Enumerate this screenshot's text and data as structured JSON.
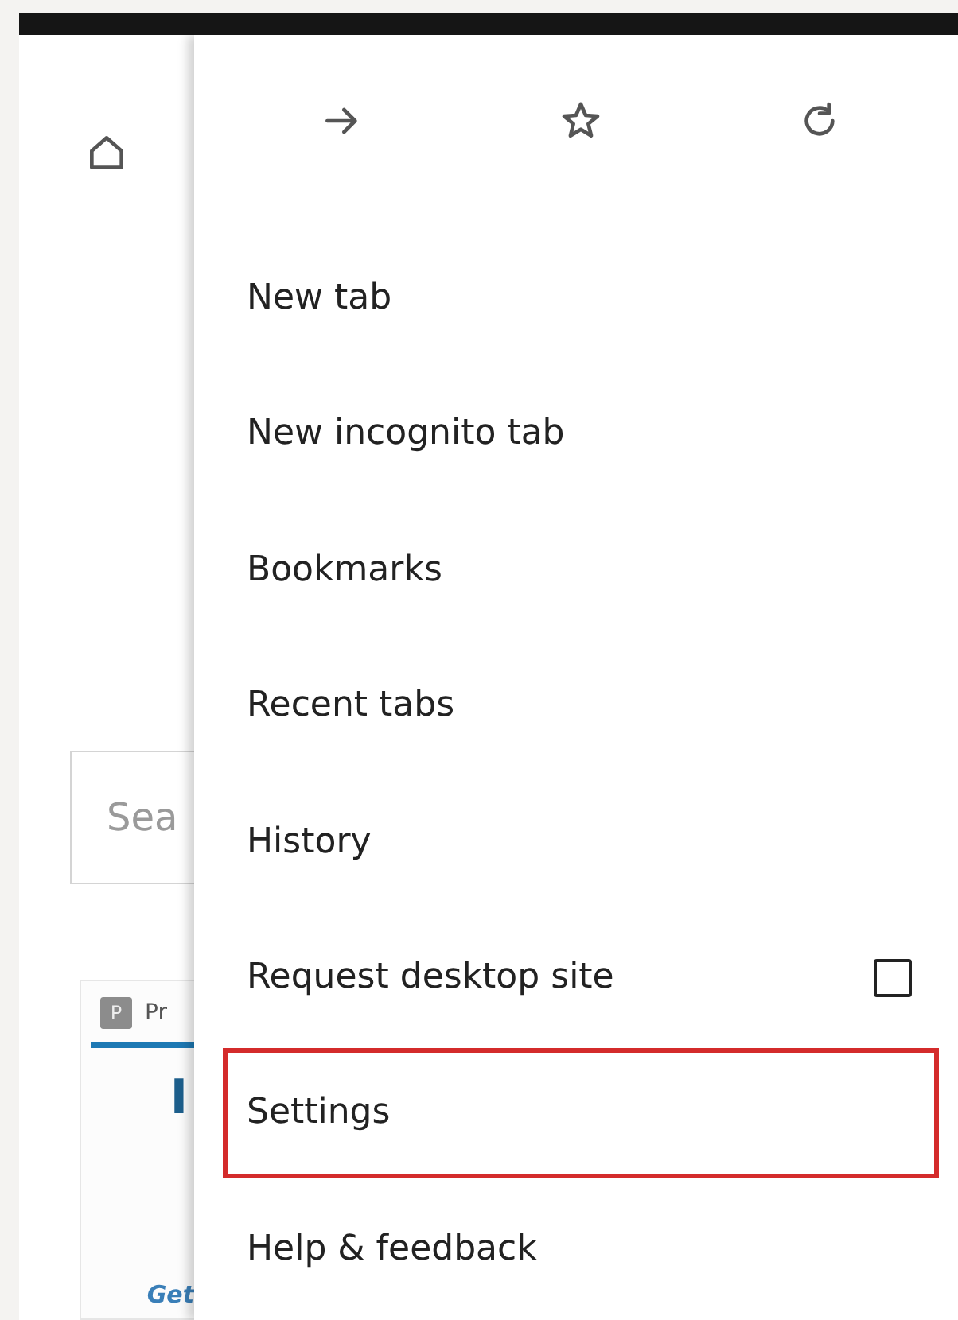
{
  "page": {
    "search": {
      "placeholder": "Sea"
    },
    "card": {
      "badge": "P",
      "tab_label": "Pr",
      "heading": "I",
      "link": "Get"
    }
  },
  "menu": {
    "items": [
      {
        "label": "New tab",
        "kind": "plain",
        "highlighted": false
      },
      {
        "label": "New incognito tab",
        "kind": "plain",
        "highlighted": false
      },
      {
        "label": "Bookmarks",
        "kind": "plain",
        "highlighted": false
      },
      {
        "label": "Recent tabs",
        "kind": "plain",
        "highlighted": false
      },
      {
        "label": "History",
        "kind": "plain",
        "highlighted": false
      },
      {
        "label": "Request desktop site",
        "kind": "checkbox",
        "checked": false,
        "highlighted": false
      },
      {
        "label": "Settings",
        "kind": "plain",
        "highlighted": true
      },
      {
        "label": "Help & feedback",
        "kind": "plain",
        "highlighted": false
      }
    ]
  }
}
